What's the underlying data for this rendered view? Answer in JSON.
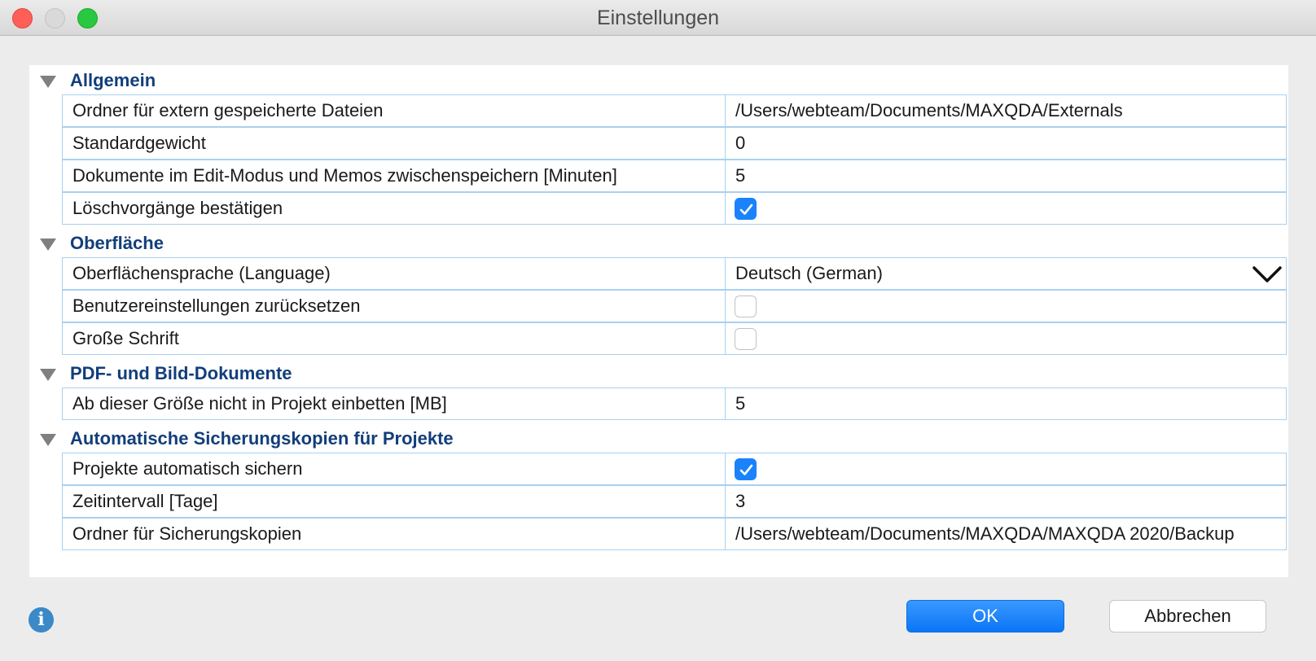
{
  "window": {
    "title": "Einstellungen"
  },
  "sections": [
    {
      "title": "Allgemein",
      "rows": [
        {
          "label": "Ordner für extern gespeicherte Dateien",
          "value": "/Users/webteam/Documents/MAXQDA/Externals"
        },
        {
          "label": "Standardgewicht",
          "value": "0"
        },
        {
          "label": "Dokumente im Edit-Modus und Memos zwischenspeichern [Minuten]",
          "value": "5"
        },
        {
          "label": "Löschvorgänge bestätigen",
          "checked": true
        }
      ]
    },
    {
      "title": "Oberfläche",
      "rows": [
        {
          "label": "Oberflächensprache (Language)",
          "value": "Deutsch (German)"
        },
        {
          "label": "Benutzereinstellungen zurücksetzen",
          "checked": false
        },
        {
          "label": "Große Schrift",
          "checked": false
        }
      ]
    },
    {
      "title": "PDF- und Bild-Dokumente",
      "rows": [
        {
          "label": "Ab dieser Größe nicht in Projekt einbetten [MB]",
          "value": "5"
        }
      ]
    },
    {
      "title": "Automatische Sicherungskopien für Projekte",
      "rows": [
        {
          "label": "Projekte automatisch sichern",
          "checked": true
        },
        {
          "label": "Zeitintervall [Tage]",
          "value": "3"
        },
        {
          "label": "Ordner für Sicherungskopien",
          "value": "/Users/webteam/Documents/MAXQDA/MAXQDA 2020/Backup"
        }
      ]
    }
  ],
  "buttons": {
    "ok": "OK",
    "cancel": "Abbrechen"
  },
  "icons": {
    "info": "i",
    "info_name": "info-icon",
    "dropdown": "chevron-down-icon"
  },
  "colors": {
    "section_title": "#123e7a",
    "checkbox_checked": "#1a82fb",
    "ok_button": "#0a75f5"
  }
}
